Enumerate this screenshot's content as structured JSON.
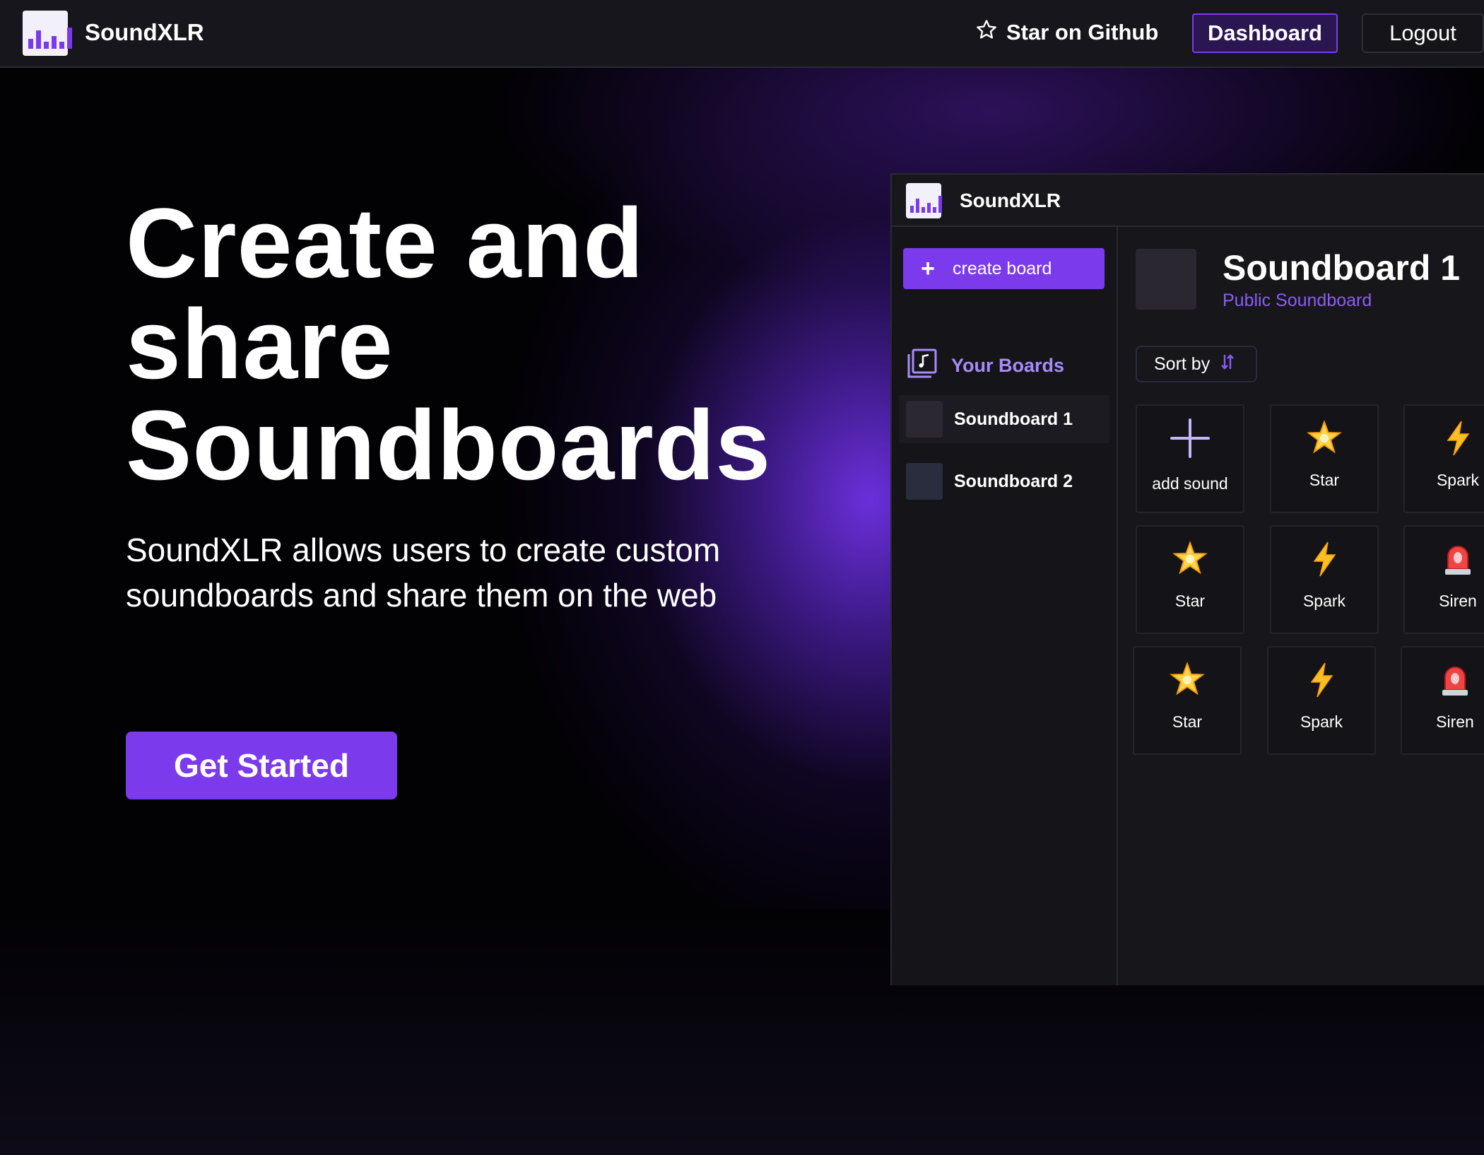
{
  "topbar": {
    "brand": "SoundXLR",
    "star_label": "Star on Github",
    "dashboard_label": "Dashboard",
    "logout_label": "Logout"
  },
  "hero": {
    "title_line1": "Create and",
    "title_line2": "share",
    "title_line3": "Soundboards",
    "subtitle": "SoundXLR allows users to create custom soundboards and share them on the web",
    "cta_label": "Get Started"
  },
  "app": {
    "brand": "SoundXLR",
    "create_board_label": "create board",
    "your_boards_label": "Your Boards",
    "boards": [
      {
        "name": "Soundboard 1",
        "color": "#2b2733"
      },
      {
        "name": "Soundboard 2",
        "color": "#2a2d3d"
      }
    ],
    "board_title": "Soundboard 1",
    "board_visibility": "Public Soundboard",
    "sort_label": "Sort by",
    "add_sound_label": "add sound",
    "sounds": [
      {
        "label": "Star",
        "icon": "star-icon"
      },
      {
        "label": "Spark",
        "icon": "spark-icon"
      },
      {
        "label": "Star",
        "icon": "star-icon"
      },
      {
        "label": "Spark",
        "icon": "spark-icon"
      },
      {
        "label": "Siren",
        "icon": "siren-icon"
      },
      {
        "label": "Star",
        "icon": "star-icon"
      },
      {
        "label": "Spark",
        "icon": "spark-icon"
      },
      {
        "label": "Siren",
        "icon": "siren-icon"
      }
    ]
  },
  "colors": {
    "accent": "#7c3aed",
    "accent_light": "#a78bfa",
    "background": "#020104"
  }
}
